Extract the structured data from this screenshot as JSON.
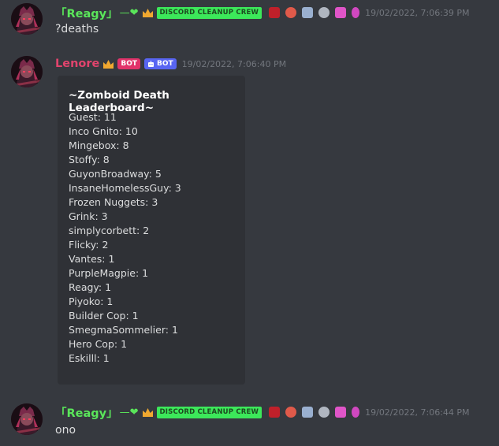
{
  "messages": [
    {
      "username": "「Reagy」",
      "name_suffix": "—❤",
      "role_badge": "DISCORD CLEANUP CREW",
      "timestamp": "19/02/2022, 7:06:39 PM",
      "content": "?deaths",
      "badges": [
        "crimson-fang-icon",
        "red-chevron-icon",
        "blue-car-icon",
        "gray-disc-icon",
        "pink-hexagon-icon",
        "pink-gem-icon"
      ]
    },
    {
      "username": "Lenore",
      "bot_tag_1": "BOT",
      "bot_tag_2": "BOT",
      "timestamp": "19/02/2022, 7:06:40 PM",
      "embed": {
        "title": "~Zomboid Death Leaderboard~",
        "entries": [
          "Guest: 11",
          "Inco Gnito: 10",
          "Mingebox: 8",
          "Stoffy: 8",
          "GuyonBroadway: 5",
          "InsaneHomelessGuy: 3",
          "Frozen Nuggets: 3",
          "Grink: 3",
          "simplycorbett: 2",
          "Flicky: 2",
          "Vantes: 1",
          "PurpleMagpie: 1",
          "Reagy: 1",
          "Piyoko: 1",
          "Builder Cop: 1",
          "SmegmaSommelier: 1",
          "Hero Cop: 1",
          "Eskilll: 1"
        ]
      }
    },
    {
      "username": "「Reagy」",
      "name_suffix": "—❤",
      "role_badge": "DISCORD CLEANUP CREW",
      "timestamp": "19/02/2022, 7:06:44 PM",
      "content": "ono",
      "badges": [
        "crimson-fang-icon",
        "red-chevron-icon",
        "blue-car-icon",
        "gray-disc-icon",
        "pink-hexagon-icon",
        "pink-gem-icon"
      ]
    }
  ],
  "colors": {
    "background": "#36393f",
    "embed_background": "#2f3136",
    "reagy_name": "#5ae65a",
    "lenore_name": "#e1446d",
    "role_badge": "#3ce85a",
    "bot_tag_pink": "#e1336a",
    "bot_tag_blue": "#5865f2",
    "timestamp": "#72767d"
  }
}
